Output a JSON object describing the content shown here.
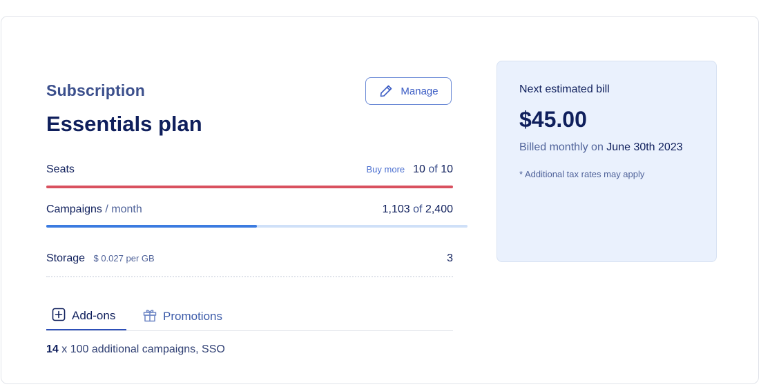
{
  "subscription": {
    "section_label": "Subscription",
    "plan_name": "Essentials plan",
    "manage_label": "Manage"
  },
  "usage": {
    "seats": {
      "label": "Seats",
      "buy_more_label": "Buy more",
      "used": "10",
      "of_word": "of",
      "total": "10",
      "fill_fraction": 1.0,
      "bar_color": "#d9515f"
    },
    "campaigns": {
      "label": "Campaigns",
      "unit": "/ month",
      "used": "1,103",
      "of_word": "of",
      "total": "2,400",
      "fill_fraction": 0.5,
      "bar_color": "#3b7be0",
      "track_color": "#cfe0f8"
    },
    "storage": {
      "label": "Storage",
      "price": "$ 0.027 per GB",
      "value": "3"
    }
  },
  "tabs": [
    {
      "label": "Add-ons",
      "icon": "plus-square-icon",
      "active": true
    },
    {
      "label": "Promotions",
      "icon": "gift-icon",
      "active": false
    }
  ],
  "addons": {
    "count": "14",
    "description": "x 100 additional campaigns, SSO"
  },
  "bill": {
    "title": "Next estimated bill",
    "amount": "$45.00",
    "cycle_prefix": "Billed monthly on",
    "date": "June 30th 2023",
    "note": "* Additional tax rates may apply"
  },
  "colors": {
    "primary_text": "#0f1f5c",
    "accent": "#3b5cc4",
    "panel_bg": "#eaf1fd"
  }
}
